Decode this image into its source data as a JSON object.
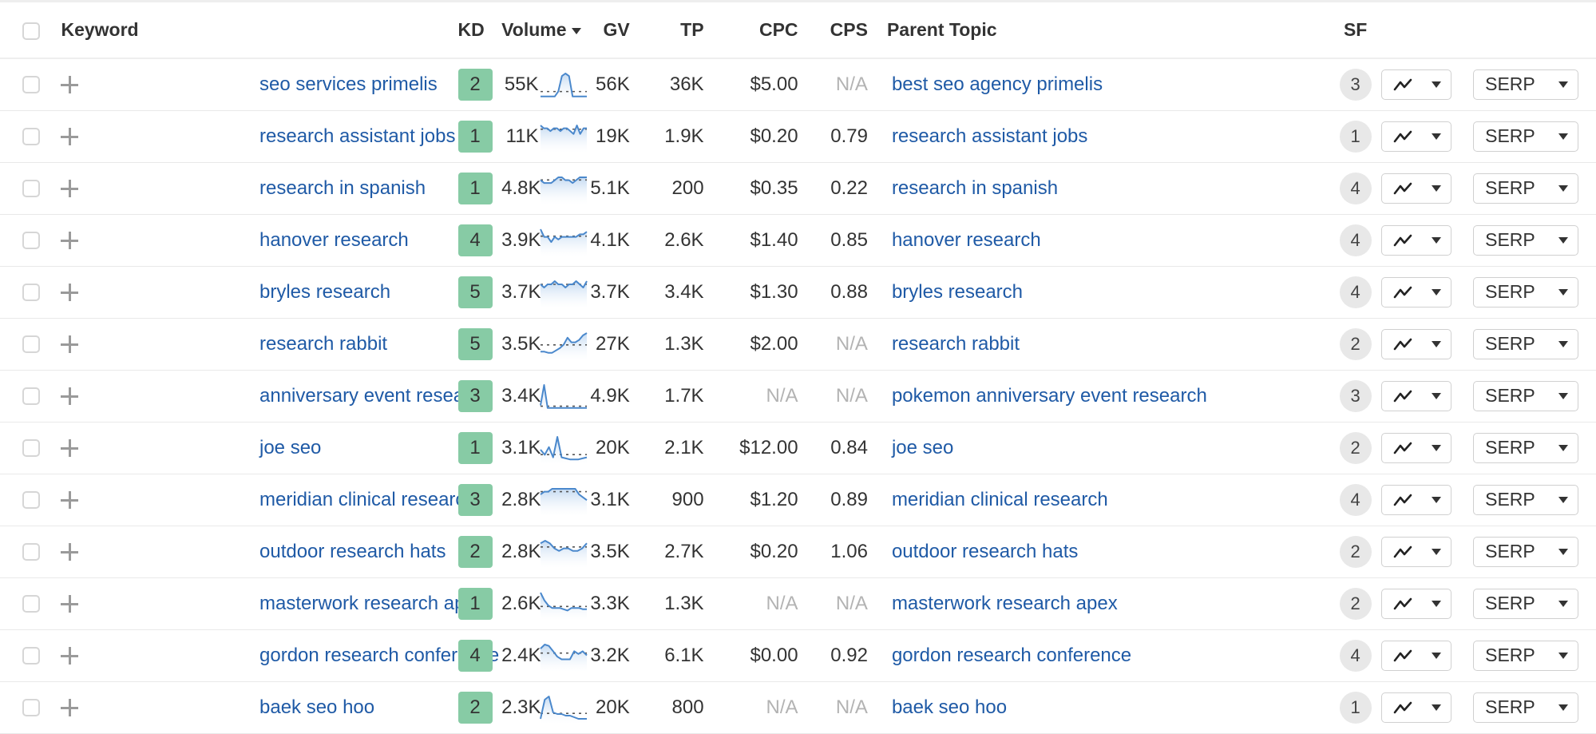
{
  "header": {
    "columns": {
      "keyword": "Keyword",
      "kd": "KD",
      "volume": "Volume",
      "gv": "GV",
      "tp": "TP",
      "cpc": "CPC",
      "cps": "CPS",
      "parent_topic": "Parent Topic",
      "sf": "SF"
    },
    "sort_column": "volume",
    "sort_direction": "desc"
  },
  "colors": {
    "link": "#1f5aa6",
    "kd_easy": "#87cba5",
    "sparkline": "#4a88cc",
    "na_text": "#b3b3b3"
  },
  "buttons": {
    "serp_label": "SERP",
    "chart_icon": "trend-line-icon"
  },
  "rows": [
    {
      "keyword": "seo services primelis",
      "kd": "2",
      "volume": "55K",
      "trend": [
        1,
        1,
        1,
        1,
        1,
        3,
        9,
        10,
        9,
        1,
        1,
        1,
        1,
        1
      ],
      "gv": "56K",
      "tp": "36K",
      "cpc": "$5.00",
      "cps": "N/A",
      "parent_topic": "best seo agency primelis",
      "sf": "3"
    },
    {
      "keyword": "research assistant jobs",
      "kd": "1",
      "volume": "11K",
      "trend": [
        9,
        8,
        8,
        7,
        8,
        8,
        7,
        8,
        8,
        7,
        6,
        9,
        6,
        8,
        8
      ],
      "gv": "19K",
      "tp": "1.9K",
      "cpc": "$0.20",
      "cps": "0.79",
      "parent_topic": "research assistant jobs",
      "sf": "1"
    },
    {
      "keyword": "research in spanish",
      "kd": "1",
      "volume": "4.8K",
      "trend": [
        8,
        7,
        7,
        7,
        8,
        9,
        9,
        8,
        8,
        7,
        8,
        9,
        9,
        9
      ],
      "gv": "5.1K",
      "tp": "200",
      "cpc": "$0.35",
      "cps": "0.22",
      "parent_topic": "research in spanish",
      "sf": "4"
    },
    {
      "keyword": "hanover research",
      "kd": "4",
      "volume": "3.9K",
      "trend": [
        10,
        7,
        7,
        5,
        7,
        6,
        7,
        7,
        7,
        7,
        7,
        8,
        8,
        9
      ],
      "gv": "4.1K",
      "tp": "2.6K",
      "cpc": "$1.40",
      "cps": "0.85",
      "parent_topic": "hanover research",
      "sf": "4"
    },
    {
      "keyword": "bryles research",
      "kd": "5",
      "volume": "3.7K",
      "trend": [
        7,
        6,
        7,
        7,
        8,
        7,
        7,
        6,
        7,
        7,
        8,
        7,
        6,
        8
      ],
      "gv": "3.7K",
      "tp": "3.4K",
      "cpc": "$1.30",
      "cps": "0.88",
      "parent_topic": "bryles research",
      "sf": "4"
    },
    {
      "keyword": "research rabbit",
      "kd": "5",
      "volume": "3.5K",
      "trend": [
        3,
        3,
        2.5,
        2.5,
        3.5,
        4.5,
        6,
        9,
        7,
        7,
        8,
        10,
        11
      ],
      "gv": "27K",
      "tp": "1.3K",
      "cpc": "$2.00",
      "cps": "N/A",
      "parent_topic": "research rabbit",
      "sf": "2"
    },
    {
      "keyword": "anniversary event research",
      "kd": "3",
      "volume": "3.4K",
      "trend": [
        2,
        10,
        1,
        1,
        1,
        1,
        1,
        1,
        1,
        1,
        1,
        1,
        1,
        1
      ],
      "gv": "4.9K",
      "tp": "1.7K",
      "cpc": "N/A",
      "cps": "N/A",
      "parent_topic": "pokemon anniversary event research",
      "sf": "3"
    },
    {
      "keyword": "joe seo",
      "kd": "1",
      "volume": "3.1K",
      "trend": [
        2.5,
        1.5,
        3,
        1,
        5,
        1,
        0.8,
        0.6,
        0.6,
        0.6,
        0.8,
        1
      ],
      "gv": "20K",
      "tp": "2.1K",
      "cpc": "$12.00",
      "cps": "0.84",
      "parent_topic": "joe seo",
      "sf": "2"
    },
    {
      "keyword": "meridian clinical research",
      "kd": "3",
      "volume": "2.8K",
      "trend": [
        7,
        8,
        8,
        9,
        9,
        9,
        9,
        9,
        9,
        9,
        7,
        6,
        5
      ],
      "gv": "3.1K",
      "tp": "900",
      "cpc": "$1.20",
      "cps": "0.89",
      "parent_topic": "meridian clinical research",
      "sf": "4"
    },
    {
      "keyword": "outdoor research hats",
      "kd": "2",
      "volume": "2.8K",
      "trend": [
        9,
        10,
        9,
        7,
        6,
        7,
        7,
        6,
        6,
        7,
        9
      ],
      "gv": "3.5K",
      "tp": "2.7K",
      "cpc": "$0.20",
      "cps": "1.06",
      "parent_topic": "outdoor research hats",
      "sf": "2"
    },
    {
      "keyword": "masterwork research apex",
      "kd": "1",
      "volume": "2.6K",
      "trend": [
        10,
        7,
        5,
        4,
        4,
        4,
        3.5,
        3,
        4,
        4,
        4,
        3.5,
        3.5
      ],
      "gv": "3.3K",
      "tp": "1.3K",
      "cpc": "N/A",
      "cps": "N/A",
      "parent_topic": "masterwork research apex",
      "sf": "2"
    },
    {
      "keyword": "gordon research conference",
      "kd": "4",
      "volume": "2.4K",
      "trend": [
        8,
        9.5,
        9,
        7,
        5,
        4,
        4,
        4,
        7,
        6,
        7,
        5.5
      ],
      "gv": "3.2K",
      "tp": "6.1K",
      "cpc": "$0.00",
      "cps": "0.92",
      "parent_topic": "gordon research conference",
      "sf": "4"
    },
    {
      "keyword": "baek seo hoo",
      "kd": "2",
      "volume": "2.3K",
      "trend": [
        1,
        7,
        8,
        3,
        2.5,
        2.5,
        2,
        2,
        1.5,
        1,
        1,
        1
      ],
      "gv": "20K",
      "tp": "800",
      "cpc": "N/A",
      "cps": "N/A",
      "parent_topic": "baek seo hoo",
      "sf": "1"
    }
  ]
}
